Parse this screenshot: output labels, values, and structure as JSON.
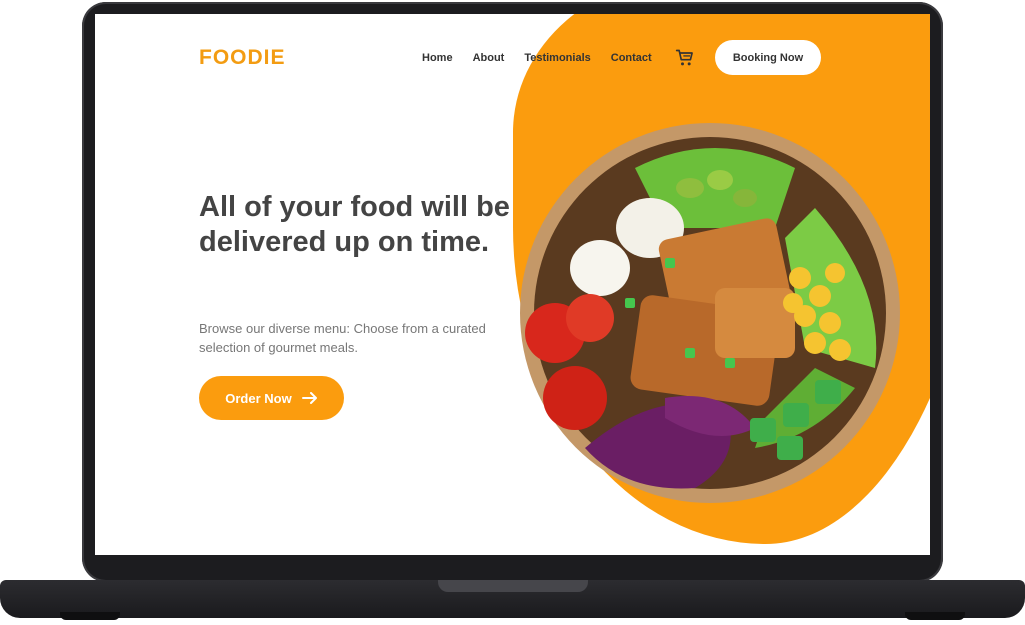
{
  "site": {
    "logo": "FOODIE",
    "nav": [
      "Home",
      "About",
      "Testimonials",
      "Contact"
    ],
    "booking_label": "Booking Now",
    "headline": "All of your food will be delivered up on time.",
    "subtext": "Browse our diverse menu: Choose from a curated selection of gourmet meals.",
    "order_label": "Order Now",
    "icons": [
      "cart-icon",
      "arrow-right-icon"
    ]
  },
  "colors": {
    "accent": "#fb9c0e",
    "logo": "#f39c12",
    "text_dark": "#444444",
    "text_muted": "#777777",
    "laptop_frame": "#1c1c1f"
  }
}
